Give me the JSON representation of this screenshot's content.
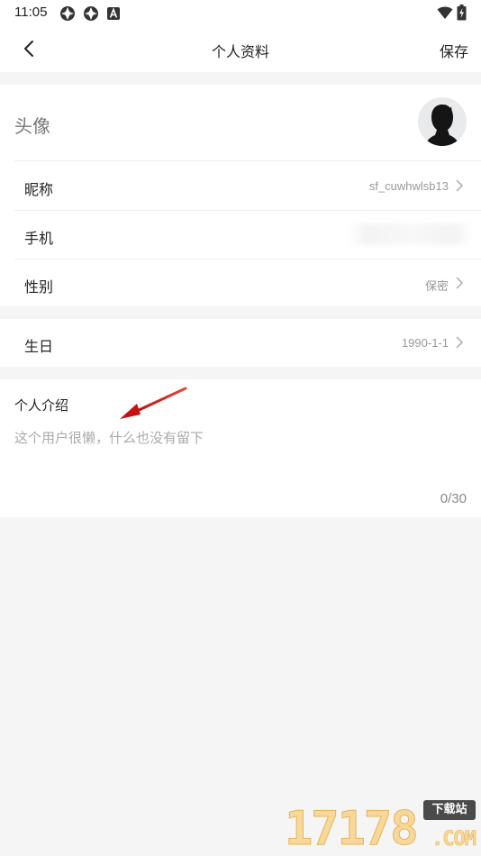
{
  "status_bar": {
    "time": "11:05",
    "left_icons": [
      "app-notification-icon",
      "app-notification-icon",
      "a-letter-icon"
    ],
    "right_icons": [
      "wifi-icon",
      "battery-charging-icon"
    ]
  },
  "header": {
    "title": "个人资料",
    "save_label": "保存",
    "back_icon": "chevron-left-icon"
  },
  "profile": {
    "avatar_label": "头像",
    "nickname": {
      "label": "昵称",
      "value": "sf_cuwhwlsb13"
    },
    "phone": {
      "label": "手机",
      "value": ""
    },
    "gender": {
      "label": "性别",
      "value": "保密"
    },
    "birthday": {
      "label": "生日",
      "value": "1990-1-1"
    }
  },
  "intro": {
    "title": "个人介绍",
    "placeholder": "这个用户很懒，什么也没有留下",
    "counter": "0/30"
  },
  "annotation": {
    "arrow_color": "#cc1111"
  },
  "watermark": {
    "number": "17178",
    "badge": "下载站",
    "suffix": ".COM"
  }
}
